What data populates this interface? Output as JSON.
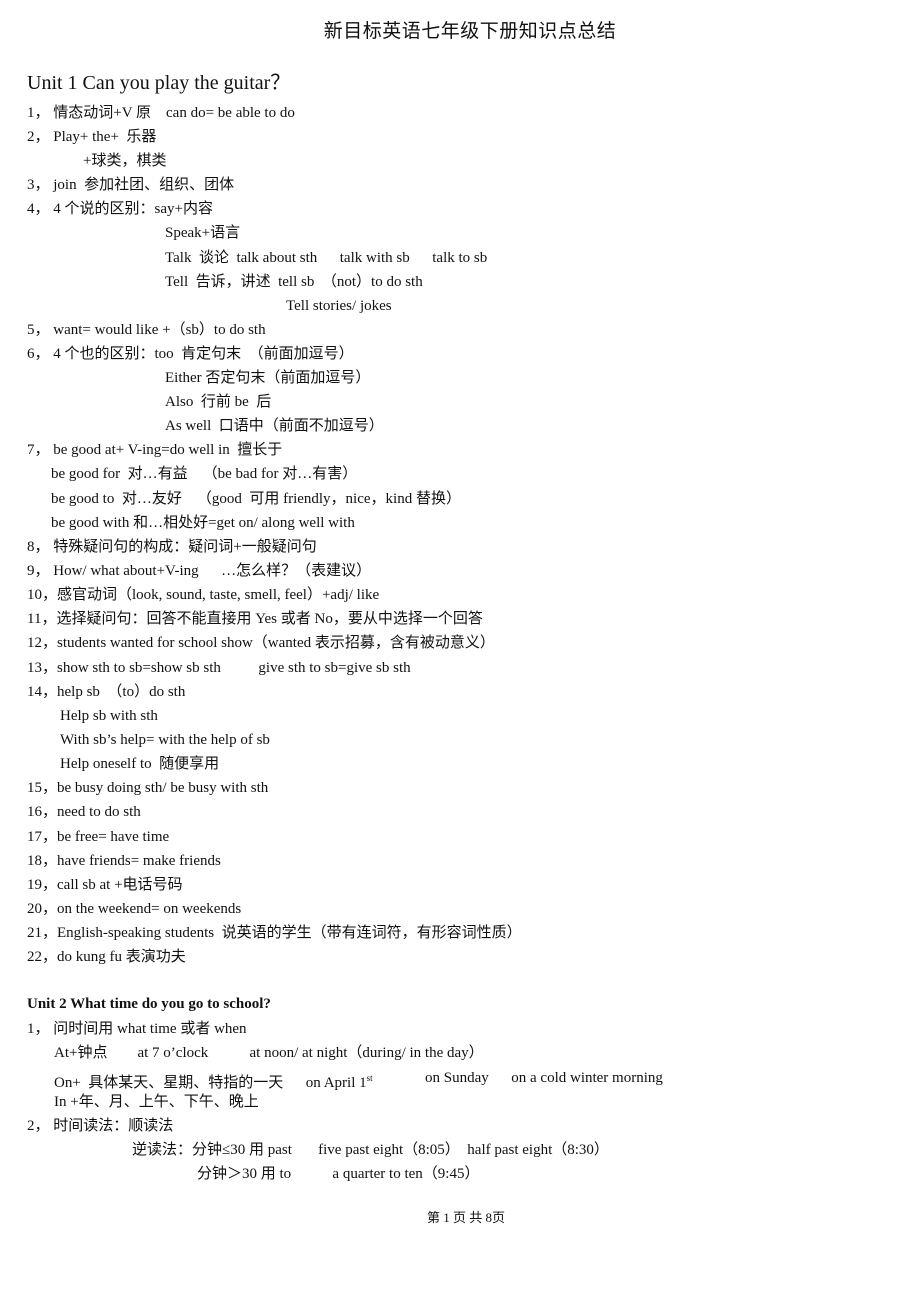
{
  "document": {
    "title": "新目标英语七年级下册知识点总结",
    "footer": "第 1 页 共 8页"
  },
  "unit1": {
    "heading": "Unit 1 Can you play the guitar？",
    "lines": [
      "1， 情态动词+V 原    can do= be able to do",
      "2， Play+ the+  乐器",
      "+球类，棋类",
      "3， join  参加社团、组织、团体",
      "4， 4 个说的区别：say+内容",
      "Speak+语言",
      "Talk  谈论  talk about sth      talk with sb      talk to sb",
      "Tell  告诉，讲述  tell sb  （not）to do sth",
      "Tell stories/ jokes",
      "5， want= would like +（sb）to do sth",
      "6， 4 个也的区别：too  肯定句末  （前面加逗号）",
      "Either 否定句末（前面加逗号）",
      "Also  行前 be  后",
      "As well  口语中（前面不加逗号）",
      "7， be good at+ V-ing=do well in  擅长于",
      "be good for  对…有益    （be bad for 对…有害）",
      "be good to  对…友好    （good  可用 friendly，nice，kind 替换）",
      "be good with 和…相处好=get on/ along well with",
      "8， 特殊疑问句的构成：疑问词+一般疑问句",
      "9， How/ what about+V-ing      …怎么样？（表建议）",
      "10，感官动词（look, sound, taste, smell, feel）+adj/ like",
      "11，选择疑问句：回答不能直接用 Yes 或者 No，要从中选择一个回答",
      "12，students wanted for school show（wanted 表示招募，含有被动意义）",
      "13，show sth to sb=show sb sth          give sth to sb=give sb sth",
      "14，help sb  （to）do sth",
      "Help sb with sth",
      "With sb’s help= with the help of sb",
      "Help oneself to  随便享用",
      "15，be busy doing sth/ be busy with sth",
      "16，need to do sth",
      "17，be free= have time",
      "18，have friends= make friends",
      "19，call sb at +电话号码",
      "20，on the weekend= on weekends",
      "21，English-speaking students  说英语的学生（带有连词符，有形容词性质）",
      "22，do kung fu 表演功夫"
    ]
  },
  "unit2": {
    "heading": "Unit 2 What time do you go to school?",
    "lines": [
      "1， 问时间用 what time 或者 when",
      "At+钟点        at 7 o’clock           at noon/ at night（during/ in the day）",
      "On+  具体某天、星期、特指的一天      on April 1",
      "st",
      "on Sunday      on a cold winter morning",
      "In +年、月、上午、下午、晚上",
      "2， 时间读法：顺读法",
      "逆读法：分钟≤30 用 past       five past eight（8:05）  half past eight（8:30）",
      "分钟＞30 用 to           a quarter to ten（9:45）"
    ]
  }
}
